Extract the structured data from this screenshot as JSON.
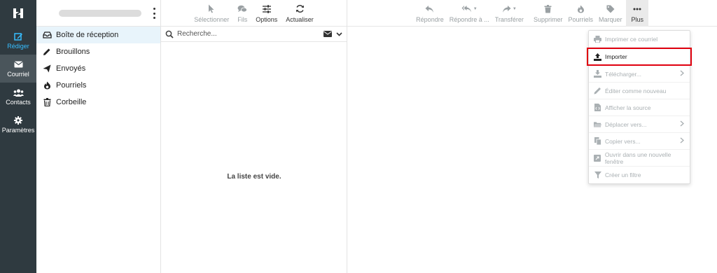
{
  "nav": {
    "items": [
      {
        "label": "Rédiger",
        "icon": "compose-icon"
      },
      {
        "label": "Courriel",
        "icon": "mail-icon"
      },
      {
        "label": "Contacts",
        "icon": "contacts-icon"
      },
      {
        "label": "Paramètres",
        "icon": "gear-icon"
      }
    ]
  },
  "folders": [
    {
      "label": "Boîte de réception",
      "icon": "inbox-icon"
    },
    {
      "label": "Brouillons",
      "icon": "pencil-icon"
    },
    {
      "label": "Envoyés",
      "icon": "send-icon"
    },
    {
      "label": "Pourriels",
      "icon": "fire-icon"
    },
    {
      "label": "Corbeille",
      "icon": "trash-icon"
    }
  ],
  "list_toolbar": {
    "select": "Sélectionner",
    "threads": "Fils",
    "options": "Options",
    "refresh": "Actualiser"
  },
  "search": {
    "placeholder": "Recherche..."
  },
  "list": {
    "empty": "La liste est vide."
  },
  "reader_toolbar": {
    "reply": "Répondre",
    "reply_all": "Répondre à ...",
    "forward": "Transférer",
    "delete": "Supprimer",
    "junk": "Pourriels",
    "mark": "Marquer",
    "more": "Plus"
  },
  "menu": {
    "items": [
      {
        "label": "Imprimer ce courriel",
        "icon": "print-icon"
      },
      {
        "label": "Importer",
        "icon": "upload-icon"
      },
      {
        "label": "Télécharger...",
        "icon": "download-icon"
      },
      {
        "label": "Éditer comme nouveau",
        "icon": "edit-icon"
      },
      {
        "label": "Afficher la source",
        "icon": "source-icon"
      },
      {
        "label": "Déplacer vers...",
        "icon": "folder-move-icon"
      },
      {
        "label": "Copier vers...",
        "icon": "copy-icon"
      },
      {
        "label": "Ouvrir dans une nouvelle fenêtre",
        "icon": "external-window-icon"
      },
      {
        "label": "Créer un filtre",
        "icon": "filter-icon"
      }
    ]
  },
  "colors": {
    "nav_bg": "#2f3a40",
    "accent": "#37beff",
    "highlight": "#e0000f"
  }
}
